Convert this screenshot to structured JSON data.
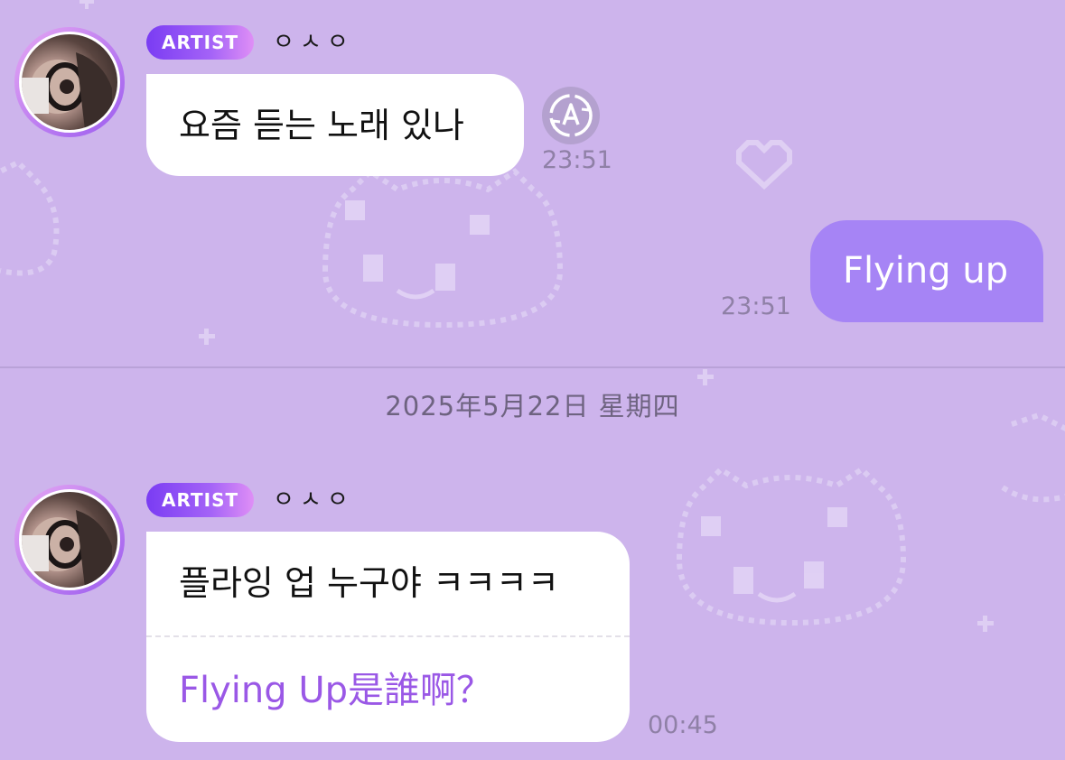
{
  "messages": [
    {
      "badge": "ARTIST",
      "sender": "ㅇㅅㅇ",
      "text": "요즘 듣는 노래 있나",
      "time": "23:51"
    },
    {
      "text": "Flying up",
      "time": "23:51"
    },
    {
      "badge": "ARTIST",
      "sender": "ㅇㅅㅇ",
      "text": "플라잉 업 누구야 ㅋㅋㅋㅋ",
      "translation": "Flying Up是誰啊？",
      "time": "00:45"
    }
  ],
  "date_separator": "2025年5月22日 星期四",
  "icons": {
    "translate": "translate-icon",
    "avatar": "avatar-image"
  },
  "colors": {
    "background": "#cdb4ec",
    "outgoing_bubble": "#a684f5",
    "badge_start": "#7a3cf3",
    "badge_end": "#df8ff6",
    "translation_text": "#9a58e6"
  }
}
